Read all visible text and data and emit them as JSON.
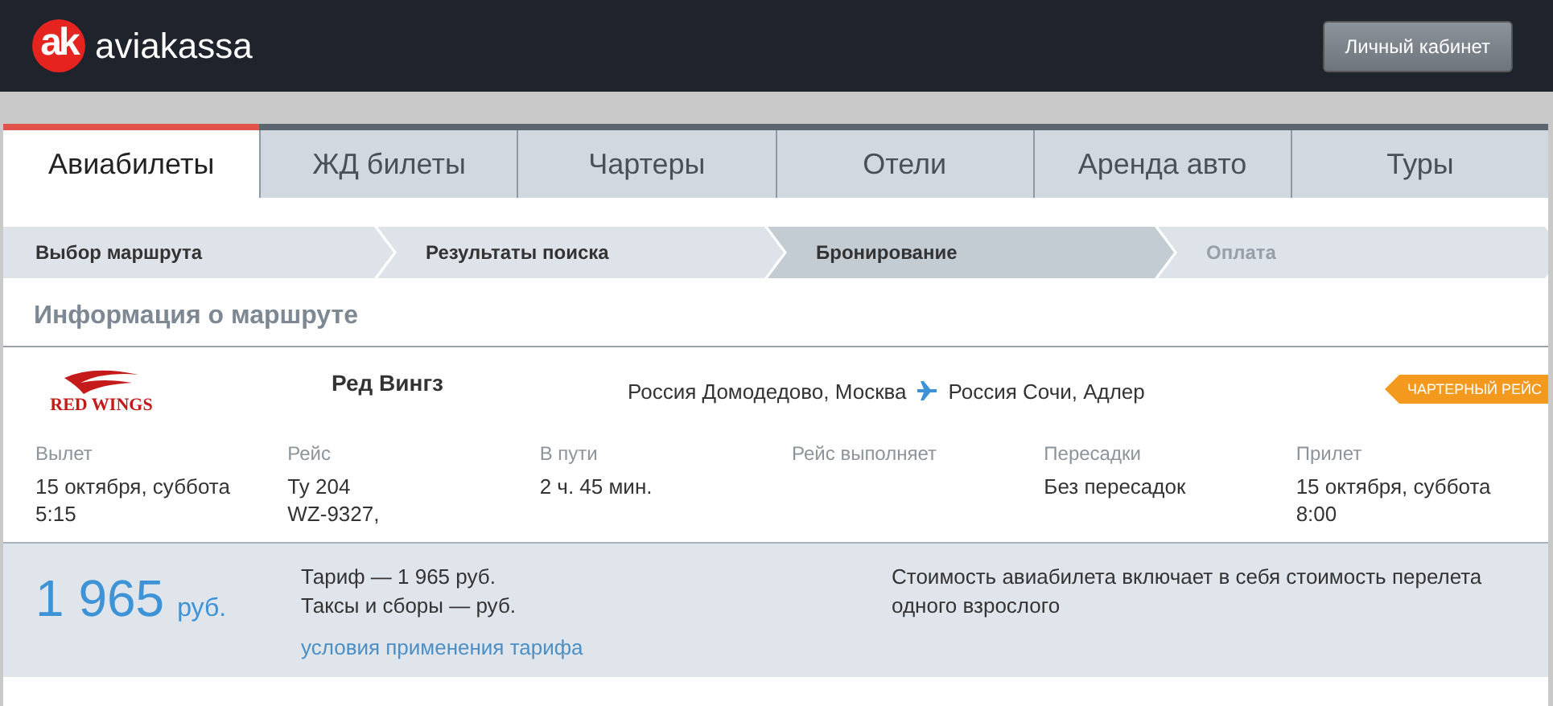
{
  "header": {
    "logo_mark": "ak",
    "logo_text": "aviakassa",
    "account_button": "Личный кабинет"
  },
  "tabs": [
    {
      "label": "Авиабилеты",
      "selected": true
    },
    {
      "label": "ЖД билеты",
      "selected": false
    },
    {
      "label": "Чартеры",
      "selected": false
    },
    {
      "label": "Отели",
      "selected": false
    },
    {
      "label": "Аренда авто",
      "selected": false
    },
    {
      "label": "Туры",
      "selected": false
    }
  ],
  "steps": [
    {
      "label": "Выбор маршрута",
      "selected": false,
      "disabled": false
    },
    {
      "label": "Результаты поиска",
      "selected": false,
      "disabled": false
    },
    {
      "label": "Бронирование",
      "selected": true,
      "disabled": false
    },
    {
      "label": "Оплата",
      "selected": false,
      "disabled": true
    }
  ],
  "route": {
    "title": "Информация о маршруте",
    "airline_logo_text": "RED WINGS",
    "airline_name": "Ред Вингз",
    "origin": "Россия Домодедово, Москва",
    "destination": "Россия Сочи, Адлер",
    "badge": "ЧАРТЕРНЫЙ РЕЙС",
    "details": [
      {
        "label": "Вылет",
        "lines": [
          "15 октября, суббота",
          "5:15"
        ]
      },
      {
        "label": "Рейс",
        "lines": [
          "Ту 204",
          "WZ-9327,"
        ]
      },
      {
        "label": "В пути",
        "lines": [
          "2 ч. 45 мин."
        ]
      },
      {
        "label": "Рейс выполняет"
      },
      {
        "label": "Пересадки",
        "lines": [
          "Без пересадок"
        ]
      },
      {
        "label": "Прилет",
        "lines": [
          "15 октября, суббота",
          "8:00"
        ]
      }
    ]
  },
  "price": {
    "amount": "1 965",
    "currency": "руб.",
    "fare": "Тариф — 1 965 руб.",
    "taxes": "Таксы и сборы — руб.",
    "conditions_link": "условия применения тарифа",
    "note": "Стоимость авиабилета включает в себя стоимость перелета одного взрослого"
  }
}
